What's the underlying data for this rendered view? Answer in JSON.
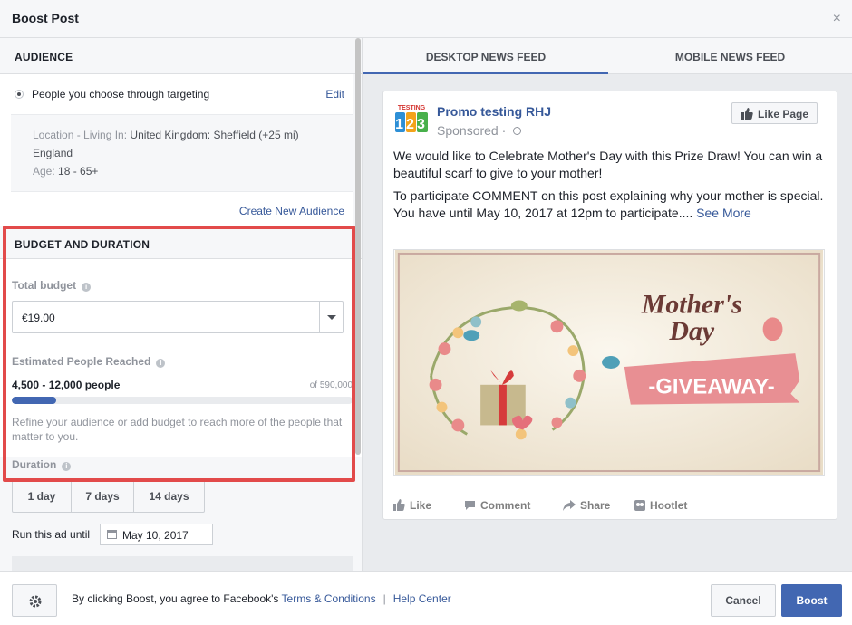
{
  "dialog": {
    "title": "Boost Post",
    "close_icon": "×"
  },
  "audience": {
    "header": "AUDIENCE",
    "option_label": "People you choose through targeting",
    "edit_label": "Edit",
    "location_key": "Location - Living In:",
    "location_value": "United Kingdom: Sheffield (+25 mi)",
    "location_value_2": "England",
    "age_key": "Age:",
    "age_value": "18 - 65+",
    "create_new": "Create New Audience"
  },
  "budget": {
    "header": "BUDGET AND DURATION",
    "total_label": "Total budget",
    "total_value": "€19.00",
    "reach_label": "Estimated People Reached",
    "reach_value": "4,500 - 12,000 people",
    "reach_of": "of 590,000",
    "reach_progress_percent": 13,
    "hint": "Refine your audience or add budget to reach more of the people that matter to you.",
    "duration_label": "Duration",
    "duration_options": [
      "1 day",
      "7 days",
      "14 days"
    ],
    "run_until_label": "Run this ad until",
    "run_until_value": "May 10, 2017"
  },
  "preview": {
    "tabs": [
      "DESKTOP NEWS FEED",
      "MOBILE NEWS FEED"
    ],
    "page_name": "Promo testing RHJ",
    "sponsored": "Sponsored · ",
    "like_page": "Like Page",
    "text_p1": "We would like to Celebrate Mother's Day with this Prize Draw! You can win a beautiful scarf to give to your mother!",
    "text_p2a": "To participate COMMENT on this post explaining why your mother is special.",
    "text_p2b": "You have until May 10, 2017 at 12pm to participate.... ",
    "see_more": "See More",
    "image_title_1": "Mother's",
    "image_title_2": "Day",
    "image_banner": "-GIVEAWAY-",
    "logo_top": "TESTING",
    "logo_digits": "123",
    "actions": [
      "Like",
      "Comment",
      "Share",
      "Hootlet"
    ]
  },
  "footer": {
    "terms_prefix": "By clicking Boost, you agree to Facebook's ",
    "terms_link": "Terms & Conditions",
    "separator": "|",
    "help_link": "Help Center",
    "cancel": "Cancel",
    "boost": "Boost"
  },
  "colors": {
    "accent": "#4267b2",
    "link": "#365899",
    "highlight": "#e24a4a"
  }
}
